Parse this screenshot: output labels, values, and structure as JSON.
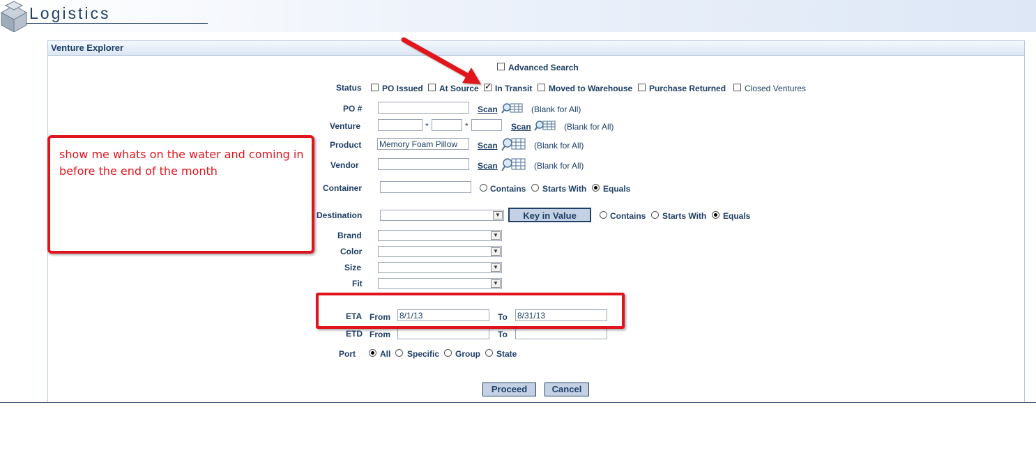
{
  "app": {
    "title": "Logistics"
  },
  "panel": {
    "title": "Venture Explorer"
  },
  "advanced_search": {
    "label": "Advanced Search",
    "checked": false
  },
  "status": {
    "label": "Status",
    "options": [
      {
        "label": "PO Issued",
        "checked": false
      },
      {
        "label": "At Source",
        "checked": false
      },
      {
        "label": "In Transit",
        "checked": true
      },
      {
        "label": "Moved to Warehouse",
        "checked": false
      },
      {
        "label": "Purchase Returned",
        "checked": false
      },
      {
        "label": "Closed Ventures",
        "checked": false
      }
    ]
  },
  "po": {
    "label": "PO #",
    "value": "",
    "scan_label": "Scan",
    "hint": "(Blank for All)"
  },
  "venture": {
    "label": "Venture",
    "sep": "*",
    "values": [
      "",
      "",
      ""
    ],
    "scan_label": "Scan",
    "hint": "(Blank for All)"
  },
  "product": {
    "label": "Product",
    "value": "Memory Foam Pillow",
    "scan_label": "Scan",
    "hint": "(Blank for All)"
  },
  "vendor": {
    "label": "Vendor",
    "value": "",
    "scan_label": "Scan",
    "hint": "(Blank for All)"
  },
  "container": {
    "label": "Container",
    "value": "",
    "match_options": [
      "Contains",
      "Starts With",
      "Equals"
    ],
    "selected": "Equals"
  },
  "destination": {
    "label": "Destination",
    "value": "",
    "key_button": "Key in Value",
    "match_options": [
      "Contains",
      "Starts With",
      "Equals"
    ],
    "selected": "Equals"
  },
  "brand": {
    "label": "Brand",
    "value": ""
  },
  "color": {
    "label": "Color",
    "value": ""
  },
  "size": {
    "label": "Size",
    "value": ""
  },
  "fit": {
    "label": "Fit",
    "value": ""
  },
  "eta": {
    "label": "ETA",
    "from_label": "From",
    "from": "8/1/13",
    "to_label": "To",
    "to": "8/31/13"
  },
  "etd": {
    "label": "ETD",
    "from_label": "From",
    "from": "",
    "to_label": "To",
    "to": ""
  },
  "port": {
    "label": "Port",
    "options": [
      "All",
      "Specific",
      "Group",
      "State"
    ],
    "selected": "All"
  },
  "buttons": {
    "proceed": "Proceed",
    "cancel": "Cancel"
  },
  "annotation": {
    "note": "show me whats on the water and coming in before the end of the month",
    "color": "#e0141c"
  },
  "colors": {
    "accent": "#1f3f66",
    "button_bg": "#c4d1e4",
    "annotation": "#e0141c"
  }
}
